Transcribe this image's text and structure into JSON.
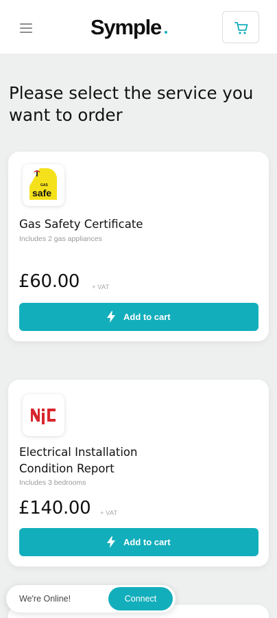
{
  "header": {
    "brand": "Symple",
    "menu_icon": "hamburger-icon",
    "cart_icon": "cart-icon",
    "accent_color": "#13aebb"
  },
  "page": {
    "title": "Please select the service you want to order"
  },
  "services": [
    {
      "name": "Gas Safety Certificate",
      "subtitle": "Includes 2 gas appliances",
      "price": "£60.00",
      "vat": "+ VAT",
      "button_label": "Add to cart",
      "button_icon": "lightning-icon",
      "badge": {
        "small_text": "GAS",
        "main_text": "safe",
        "bg_color": "#f5e11b"
      }
    },
    {
      "name_line1": "Electrical Installation",
      "name_line2": "Condition Report",
      "subtitle": "Includes 3 bedrooms",
      "price": "£140.00",
      "vat": "+ VAT",
      "button_label": "Add to cart",
      "button_icon": "lightning-icon",
      "badge": {
        "main_text": "NIC",
        "color": "#d8262e"
      }
    }
  ],
  "chat": {
    "status": "We're Online!",
    "connect_label": "Connect"
  }
}
